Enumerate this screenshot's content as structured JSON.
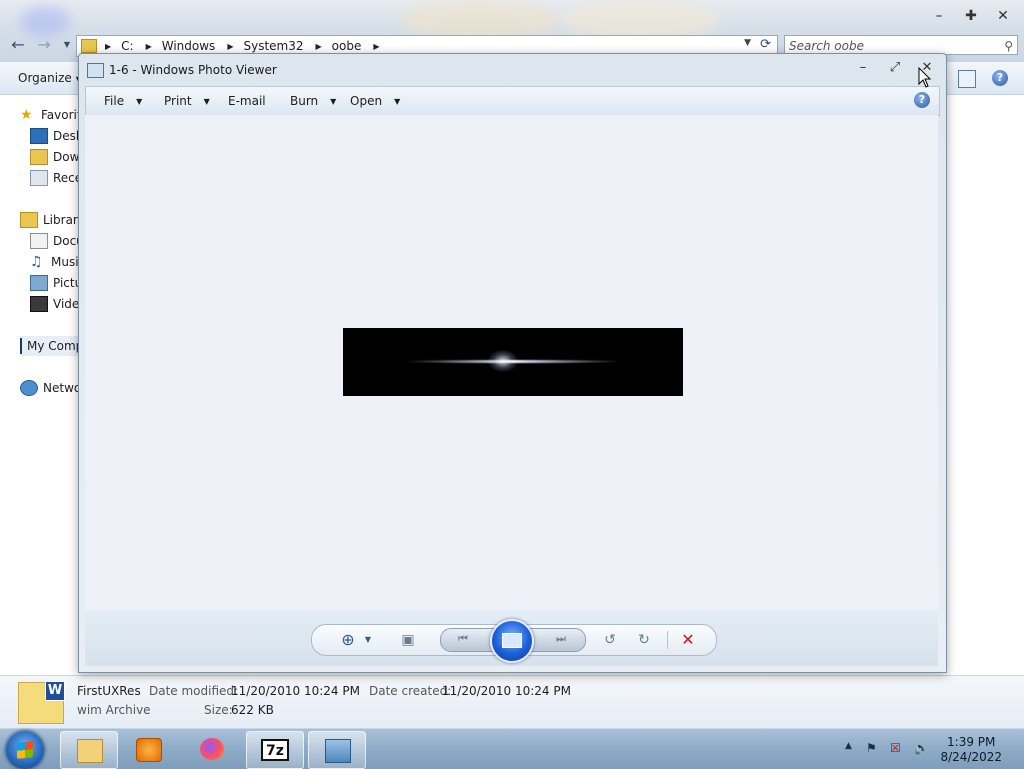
{
  "explorer": {
    "breadcrumbs": [
      "C:",
      "Windows",
      "System32",
      "oobe"
    ],
    "search_placeholder": "Search oobe",
    "organize_label": "Organize",
    "nav_items": [
      {
        "label": "Favorites",
        "icon": "star-icon"
      },
      {
        "label": "Desktop",
        "icon": "desktop-icon"
      },
      {
        "label": "Downloads",
        "icon": "downloads-icon"
      },
      {
        "label": "Recent Places",
        "icon": "recent-icon"
      },
      {
        "label": "Libraries",
        "icon": "libraries-icon"
      },
      {
        "label": "Documents",
        "icon": "documents-icon"
      },
      {
        "label": "Music",
        "icon": "music-icon"
      },
      {
        "label": "Pictures",
        "icon": "pictures-icon"
      },
      {
        "label": "Videos",
        "icon": "videos-icon"
      },
      {
        "label": "My Computer",
        "icon": "computer-icon"
      },
      {
        "label": "Network",
        "icon": "network-icon"
      }
    ],
    "details": {
      "file_name": "FirstUXRes",
      "file_type": "wim Archive",
      "date_modified_label": "Date modified:",
      "date_modified": "11/20/2010 10:24 PM",
      "date_created_label": "Date created:",
      "date_created": "11/20/2010 10:24 PM",
      "size_label": "Size:",
      "size": "622 KB"
    }
  },
  "photo_viewer": {
    "title": "1-6 - Windows Photo Viewer",
    "menus": [
      {
        "label": "File",
        "has_dropdown": true
      },
      {
        "label": "Print",
        "has_dropdown": true
      },
      {
        "label": "E-mail",
        "has_dropdown": false
      },
      {
        "label": "Burn",
        "has_dropdown": true
      },
      {
        "label": "Open",
        "has_dropdown": true
      }
    ],
    "help_glyph": "?",
    "toolbar_icons": [
      "zoom-icon",
      "actual-size-icon",
      "previous-icon",
      "slideshow-icon",
      "next-icon",
      "rotate-left-icon",
      "rotate-right-icon",
      "delete-icon"
    ]
  },
  "taskbar": {
    "apps": [
      "explorer-icon",
      "media-player-icon",
      "firefox-icon",
      "7zip-icon",
      "photo-viewer-icon"
    ],
    "seven_zip_label": "7z",
    "time": "1:39 PM",
    "date": "8/24/2022"
  }
}
